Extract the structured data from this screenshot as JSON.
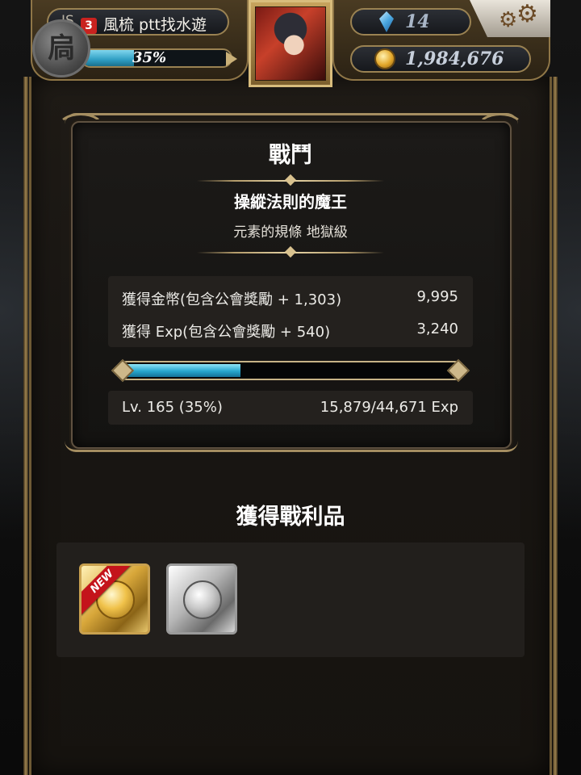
{
  "header": {
    "name_prefix": "IS",
    "player_level_badge": "3",
    "player_name": "風梳 ptt找水遊",
    "rank_emblem_glyph": "扃",
    "exp_percent_label": "35%",
    "exp_progress": 0.35,
    "gems": "14",
    "gold": "1,984,676"
  },
  "battle": {
    "title": "戰鬥",
    "stage_name": "操縱法則的魔王",
    "stage_difficulty": "元素的規條 地獄級",
    "gold_reward_label": "獲得金幣(包含公會獎勵 + 1,303)",
    "gold_reward_value": "9,995",
    "exp_reward_label": "獲得 Exp(包含公會獎勵 + 540)",
    "exp_reward_value": "3,240",
    "level_text": "Lv. 165 (35%)",
    "level_progress": 0.35,
    "exp_total_text": "15,879/44,671 Exp"
  },
  "loot": {
    "title": "獲得戰利品",
    "new_badge": "NEW",
    "items": [
      {
        "icon": "gold-coin-card-icon",
        "is_new": true
      },
      {
        "icon": "silver-coin-card-icon",
        "is_new": false
      }
    ]
  },
  "colors": {
    "accent_gold": "#a58e61",
    "exp_cyan": "#27a6cd",
    "badge_red": "#c9221f"
  }
}
